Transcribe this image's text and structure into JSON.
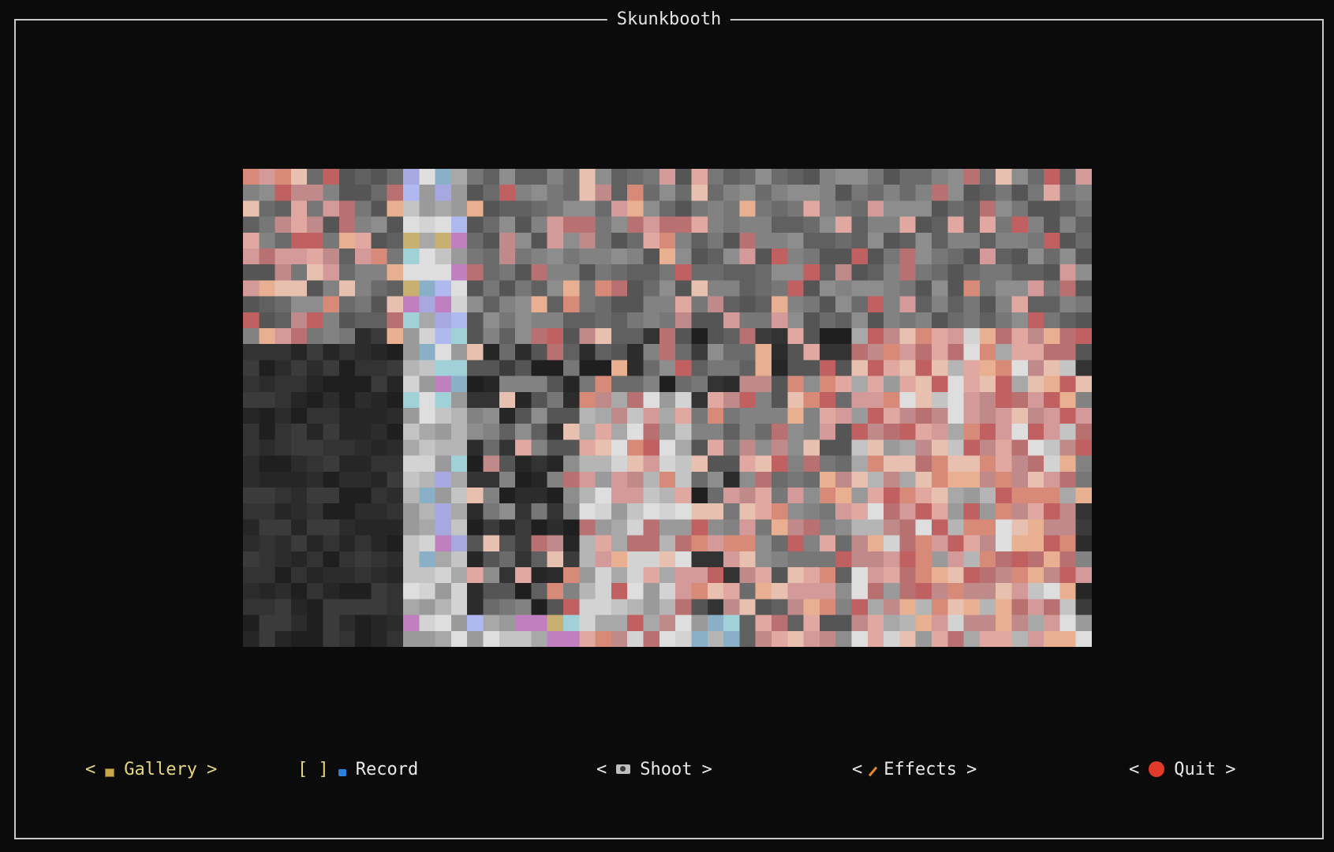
{
  "window": {
    "title": "Skunkbooth"
  },
  "toolbar": {
    "gallery": {
      "open": "<",
      "label": "Gallery",
      "close": ">",
      "icon": "picture-icon"
    },
    "record": {
      "open": "[ ]",
      "label": "Record",
      "icon": "record-icon"
    },
    "shoot": {
      "open": "<",
      "label": "Shoot",
      "close": ">",
      "icon": "camera-icon"
    },
    "effects": {
      "open": "<",
      "label": "Effects",
      "close": ">",
      "icon": "magic-wand-icon"
    },
    "quit": {
      "open": "<",
      "label": "Quit",
      "close": ">",
      "icon": "red-circle-icon"
    }
  },
  "colors": {
    "background": "#0b0b0b",
    "border": "#c9c9c9",
    "focused_text": "#e8d77a",
    "quit_icon": "#e23a2a"
  }
}
